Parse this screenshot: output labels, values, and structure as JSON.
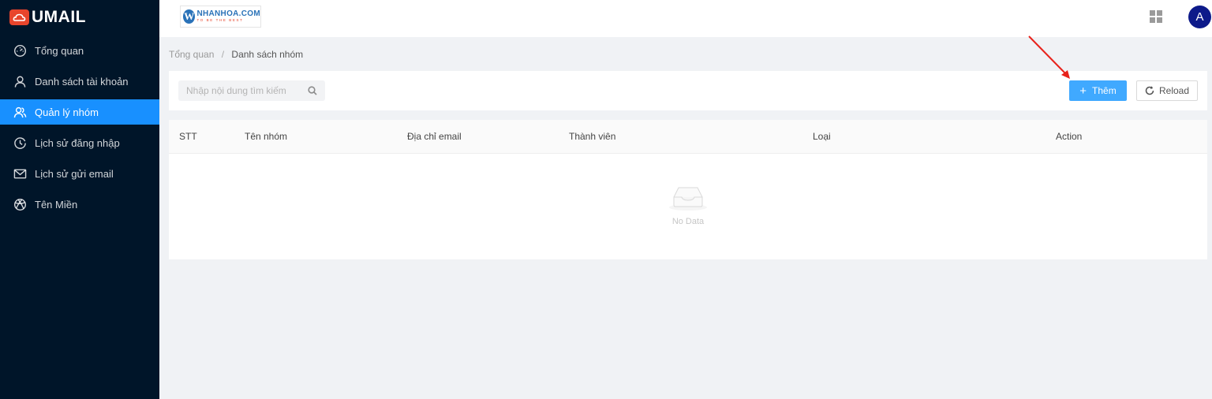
{
  "brand": {
    "name": "UMAIL"
  },
  "partner": {
    "name": "NHANHOA.COM",
    "tagline": "TO BE THE BEST",
    "initial": "W"
  },
  "user": {
    "avatar_initial": "A"
  },
  "sidebar": {
    "items": [
      {
        "label": "Tổng quan",
        "icon": "dashboard-icon"
      },
      {
        "label": "Danh sách tài khoản",
        "icon": "user-icon"
      },
      {
        "label": "Quản lý nhóm",
        "icon": "group-icon",
        "active": true
      },
      {
        "label": "Lịch sử đăng nhập",
        "icon": "clock-icon"
      },
      {
        "label": "Lịch sử gửi email",
        "icon": "mail-icon"
      },
      {
        "label": "Tên Miền",
        "icon": "globe-icon"
      }
    ]
  },
  "breadcrumb": {
    "home": "Tổng quan",
    "separator": "/",
    "current": "Danh sách nhóm"
  },
  "toolbar": {
    "search_placeholder": "Nhập nội dung tìm kiếm",
    "add_label": "Thêm",
    "reload_label": "Reload"
  },
  "table": {
    "columns": [
      "STT",
      "Tên nhóm",
      "Địa chỉ email",
      "Thành viên",
      "Loại",
      "Action"
    ],
    "rows": [],
    "empty_text": "No Data"
  },
  "colors": {
    "sidebar_bg": "#001529",
    "active": "#1890ff",
    "primary_button": "#40a9ff",
    "brand_accent": "#e8452c",
    "avatar_bg": "#0d1a8a"
  }
}
